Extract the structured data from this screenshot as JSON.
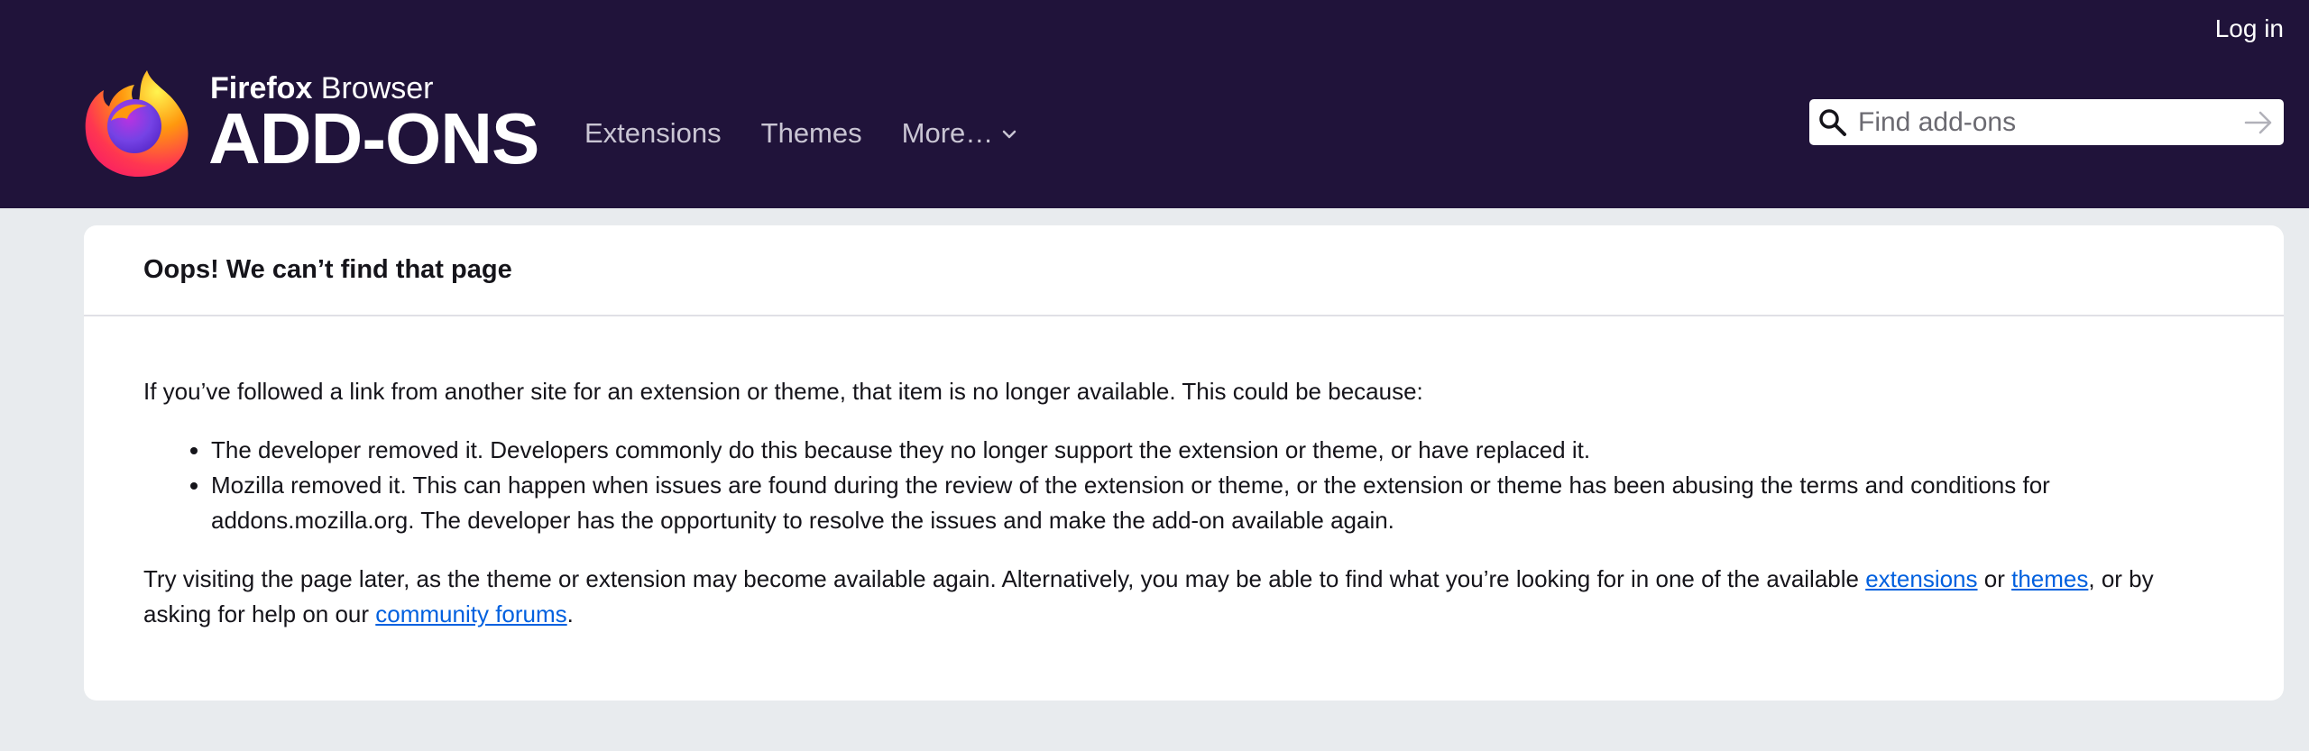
{
  "header": {
    "login_label": "Log in",
    "logo_small_bold": "Firefox",
    "logo_small_regular": " Browser",
    "logo_big": "ADD-ONS",
    "nav": {
      "extensions": "Extensions",
      "themes": "Themes",
      "more": "More…"
    },
    "search": {
      "placeholder": "Find add-ons",
      "value": ""
    }
  },
  "error": {
    "title": "Oops! We can’t find that page",
    "intro": "If you’ve followed a link from another site for an extension or theme, that item is no longer available. This could be because:",
    "reasons": [
      "The developer removed it. Developers commonly do this because they no longer support the extension or theme, or have replaced it.",
      "Mozilla removed it. This can happen when issues are found during the review of the extension or theme, or the extension or theme has been abusing the terms and conditions for addons.mozilla.org. The developer has the opportunity to resolve the issues and make the add-on available again."
    ],
    "suggestion_before": "Try visiting the page later, as the theme or extension may become available again. Alternatively, you may be able to find what you’re looking for in one of the available ",
    "link_extensions": "extensions",
    "word_or": " or ",
    "link_themes": "themes",
    "suggestion_middle": ", or by asking for help on our ",
    "link_forums": "community forums",
    "suggestion_end": "."
  },
  "colors": {
    "header_bg": "#20133a",
    "page_bg": "#e8ebee",
    "link": "#0060df"
  },
  "icons": {
    "logo": "firefox-logo-icon",
    "search": "search-icon",
    "submit": "arrow-right-icon",
    "dropdown": "chevron-down-icon"
  }
}
